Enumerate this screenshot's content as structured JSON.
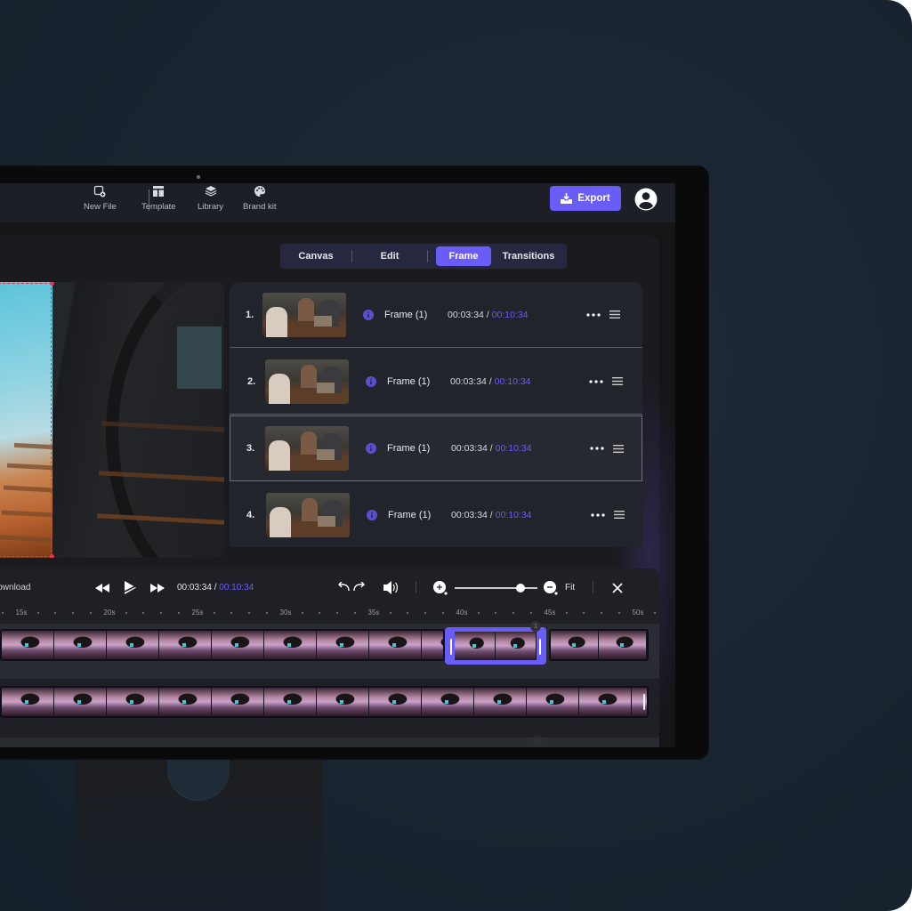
{
  "toolbar": {
    "items": [
      {
        "label": "New File",
        "icon": "new-file-icon"
      },
      {
        "label": "Template",
        "icon": "template-icon"
      },
      {
        "label": "Library",
        "icon": "layers-icon"
      },
      {
        "label": "Brand kit",
        "icon": "palette-icon"
      }
    ],
    "export_label": "Export",
    "export_icon": "download-tray-icon",
    "avatar_icon": "user-avatar-icon"
  },
  "tabs": [
    {
      "label": "Canvas",
      "active": false
    },
    {
      "label": "Edit",
      "active": false
    },
    {
      "label": "Frame",
      "active": true
    },
    {
      "label": "Transitions",
      "active": false
    }
  ],
  "frames": [
    {
      "num": "1.",
      "label": "Frame (1)",
      "current": "00:03:34",
      "separator": " / ",
      "total": "00:10:34",
      "selected": false
    },
    {
      "num": "2.",
      "label": "Frame (1)",
      "current": "00:03:34",
      "separator": " / ",
      "total": "00:10:34",
      "selected": false
    },
    {
      "num": "3.",
      "label": "Frame (1)",
      "current": "00:03:34",
      "separator": " / ",
      "total": "00:10:34",
      "selected": true
    },
    {
      "num": "4.",
      "label": "Frame (1)",
      "current": "00:03:34",
      "separator": " / ",
      "total": "00:10:34",
      "selected": false
    }
  ],
  "editor": {
    "download_label": "Download",
    "current_time": "00:03:34",
    "separator": " / ",
    "total_time": "00:10:34",
    "fit_label": "Fit",
    "zoom_level": 0.8,
    "ruler": [
      "15s",
      "20s",
      "25s",
      "30s",
      "35s",
      "40s",
      "45s",
      "50s"
    ],
    "clip_badge": "1"
  },
  "colors": {
    "accent": "#6a5cf6",
    "selection_dashed": "#e8334f",
    "background": "#1a2430"
  }
}
